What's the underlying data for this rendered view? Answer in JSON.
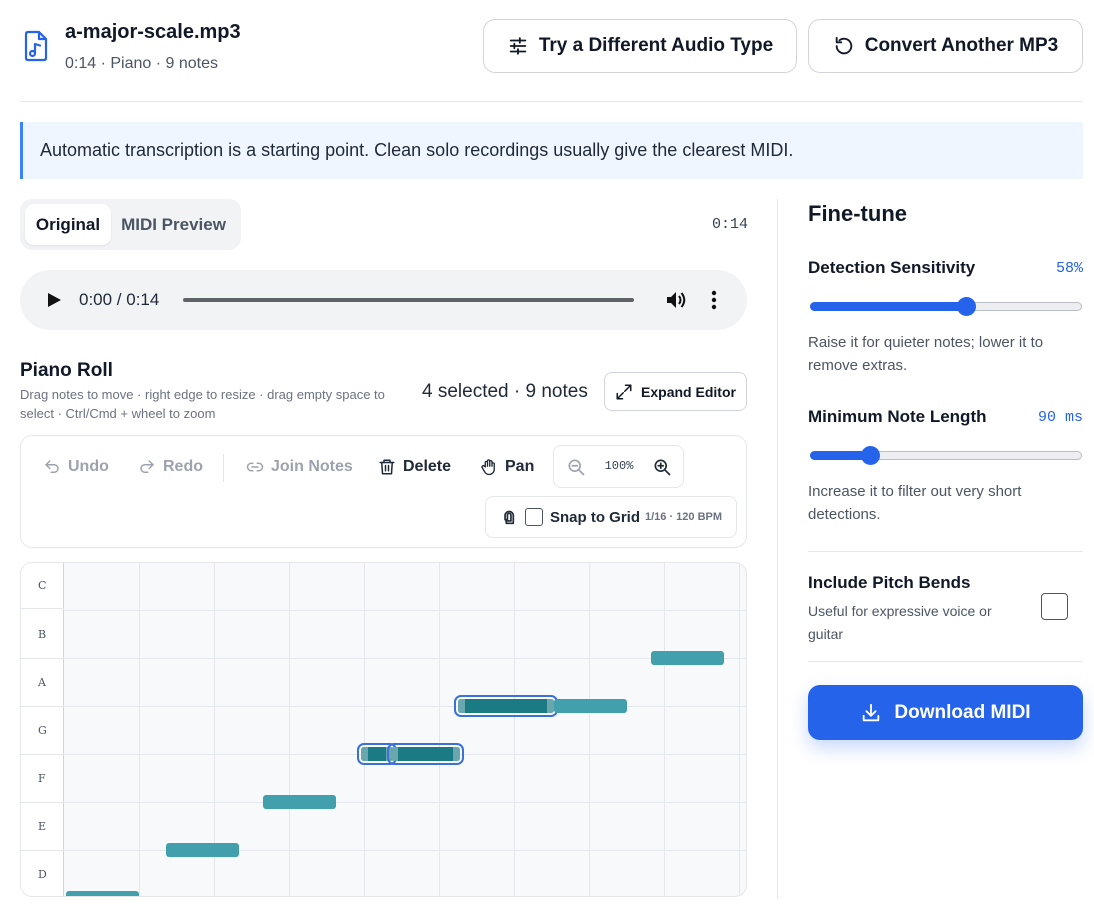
{
  "header": {
    "file_name": "a-major-scale.mp3",
    "file_meta": "0:14 · Piano · 9 notes",
    "try_button": "Try a Different Audio Type",
    "convert_button": "Convert Another MP3"
  },
  "banner": {
    "text": "Automatic transcription is a starting point. Clean solo recordings usually give the clearest MIDI."
  },
  "tabs": [
    {
      "label": "Original",
      "active": true
    },
    {
      "label": "MIDI Preview",
      "active": false
    }
  ],
  "duration": "0:14",
  "audio": {
    "time": "0:00 / 0:14",
    "progress": 0
  },
  "piano_roll": {
    "title": "Piano Roll",
    "help": "Drag notes to move · right edge to resize · drag empty space to select · Ctrl/Cmd + wheel to zoom",
    "count": "4 selected · 9 notes",
    "expand_label": "Expand Editor",
    "keys": [
      "C",
      "B",
      "A",
      "G",
      "F",
      "E",
      "D"
    ]
  },
  "toolbar": {
    "undo": "Undo",
    "redo": "Redo",
    "join": "Join Notes",
    "delete": "Delete",
    "pan": "Pan",
    "zoom": "100%",
    "snap_label": "Snap to Grid",
    "snap_meta": "1/16 · 120 BPM",
    "snap_checked": false
  },
  "notes": [
    {
      "pitch": "D",
      "start": 0.0,
      "length": 1.0,
      "selected": false
    },
    {
      "pitch": "E",
      "start": 1.33,
      "length": 1.0,
      "selected": false
    },
    {
      "pitch": "F",
      "start": 2.63,
      "length": 1.0,
      "selected": false
    },
    {
      "pitch": "G",
      "start": 3.93,
      "length": 0.45,
      "selected": true
    },
    {
      "pitch": "G",
      "start": 4.33,
      "length": 0.95,
      "selected": true
    },
    {
      "pitch": "A",
      "start": 5.23,
      "length": 1.3,
      "selected": true
    },
    {
      "pitch": "A",
      "start": 6.5,
      "length": 1.0,
      "selected": false
    },
    {
      "pitch": "B",
      "start": 7.8,
      "length": 1.0,
      "selected": false
    }
  ],
  "fine_tune": {
    "title": "Fine-tune",
    "sensitivity": {
      "label": "Detection Sensitivity",
      "value": "58%",
      "fraction": 0.58,
      "help": "Raise it for quieter notes; lower it to remove extras."
    },
    "min_length": {
      "label": "Minimum Note Length",
      "value": "90 ms",
      "fraction": 0.2,
      "help": "Increase it to filter out very short detections."
    },
    "pitch_bends": {
      "label": "Include Pitch Bends",
      "help": "Useful for expressive voice or guitar",
      "checked": false
    },
    "download": "Download MIDI"
  },
  "colors": {
    "accent": "#2563eb",
    "note": "#42a0ad",
    "note_selected": "#1a7b85"
  }
}
